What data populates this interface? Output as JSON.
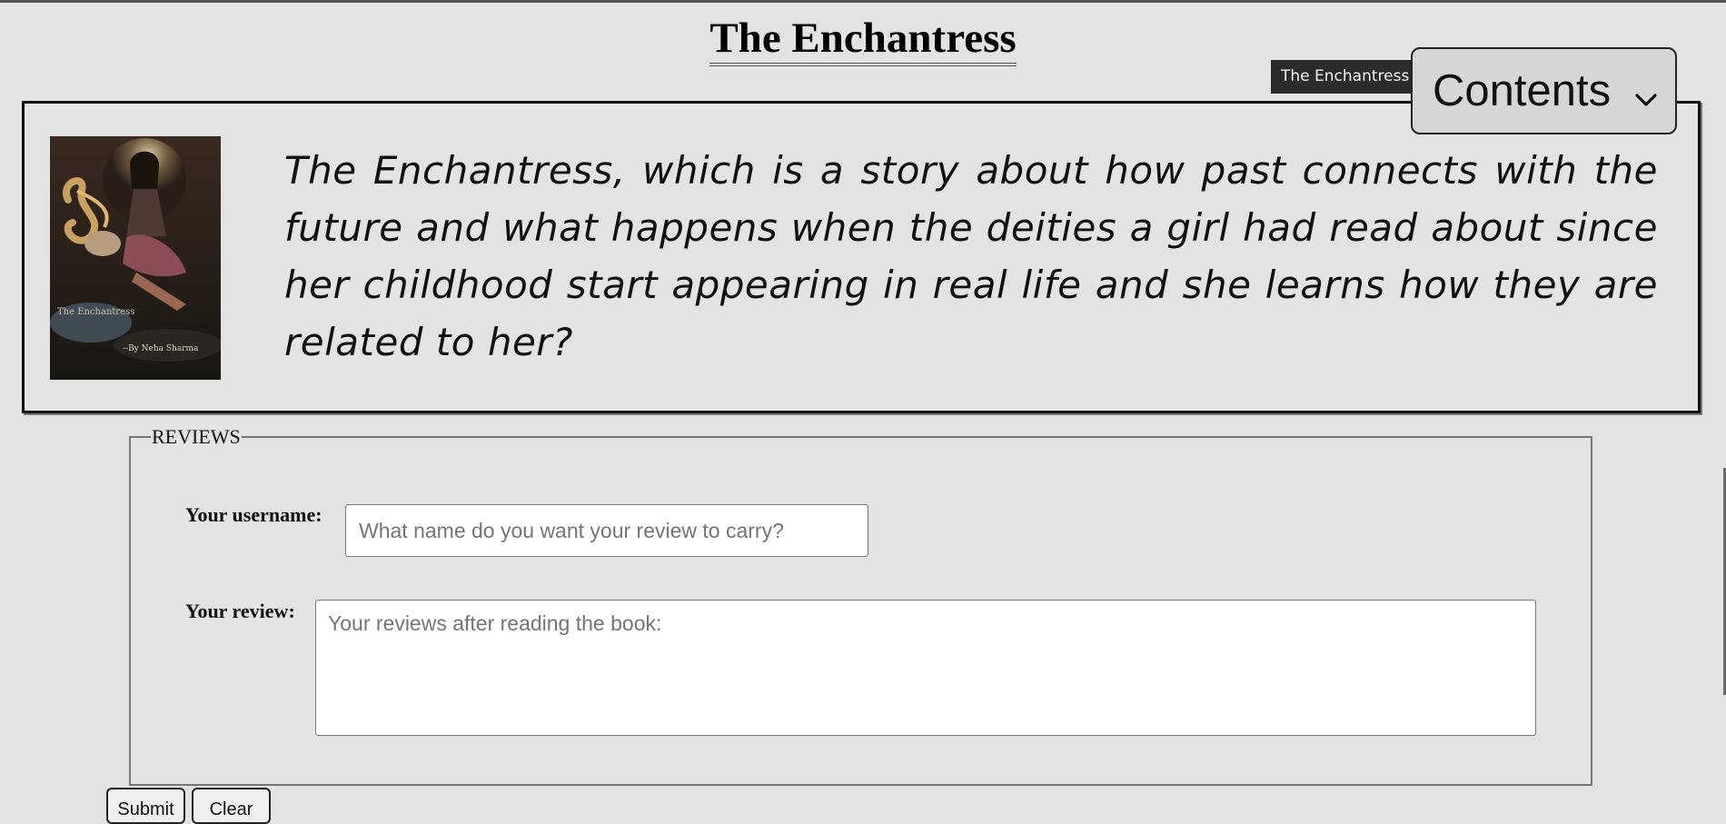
{
  "page": {
    "title": "The Enchantress"
  },
  "header": {
    "tooltip": "The Enchantress",
    "contents_label": "Contents",
    "contents_icon": "chevron-down-icon"
  },
  "book": {
    "cover_alt": "The Enchantress",
    "cover_text": "The Enchantress",
    "cover_author": "--By Neha Sharma",
    "blurb": "The Enchantress, which is a story about how past connects with the future and what happens when the deities a girl had read about since her childhood start appearing in real life and she learns how they are related to her?"
  },
  "reviews": {
    "legend": "REVIEWS",
    "username_label": "Your username:",
    "username_placeholder": "What name do you want your review to carry?",
    "review_label": "Your review:",
    "review_placeholder": "Your reviews after reading the book:",
    "submit_label": "Submit",
    "clear_label": "Clear"
  }
}
